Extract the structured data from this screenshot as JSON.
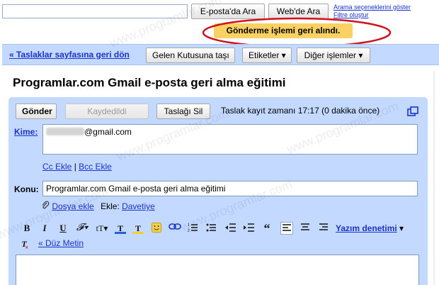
{
  "search": {
    "query": "",
    "mail_search_label": "E-posta'da Ara",
    "web_search_label": "Web'de Ara",
    "options_link": "Arama seçeneklerini göster",
    "filter_link": "Filtre oluştur"
  },
  "notification": {
    "text": "Gönderme işlemi geri alındı."
  },
  "action_bar": {
    "back_link": "« Taslaklar sayfasına geri dön",
    "inbox_button": "Gelen Kutusuna taşı",
    "labels_button": "Etiketler ▾",
    "more_button": "Diğer işlemler ▾"
  },
  "message": {
    "subject_title": "Programlar.com Gmail e-posta geri alma eğitimi"
  },
  "compose": {
    "send_button": "Gönder",
    "saved_button": "Kaydedildi",
    "delete_button": "Taslağı Sil",
    "draft_status": "Taslak kayıt zamanı 17:17 (0 dakika önce)",
    "to_label": "Kime:",
    "to_value": "@gmail.com",
    "cc_link": "Cc Ekle",
    "separator": "|",
    "bcc_link": "Bcc Ekle",
    "subject_label": "Konu:",
    "subject_value": "Programlar.com Gmail e-posta geri alma eğitimi",
    "attach_link": "Dosya ekle",
    "insert_label": "Ekle:",
    "invite_link": "Davetiye",
    "spellcheck_link": "Yazım denetimi",
    "spellcheck_arrow": "▾",
    "plain_text_link": "« Düz Metin"
  },
  "watermark": "www.programlar.com",
  "colors": {
    "compose_bg": "#c3d9ff",
    "notification_bg": "#fad163",
    "highlight_ring": "#d0101a",
    "link": "#1a33c8"
  }
}
